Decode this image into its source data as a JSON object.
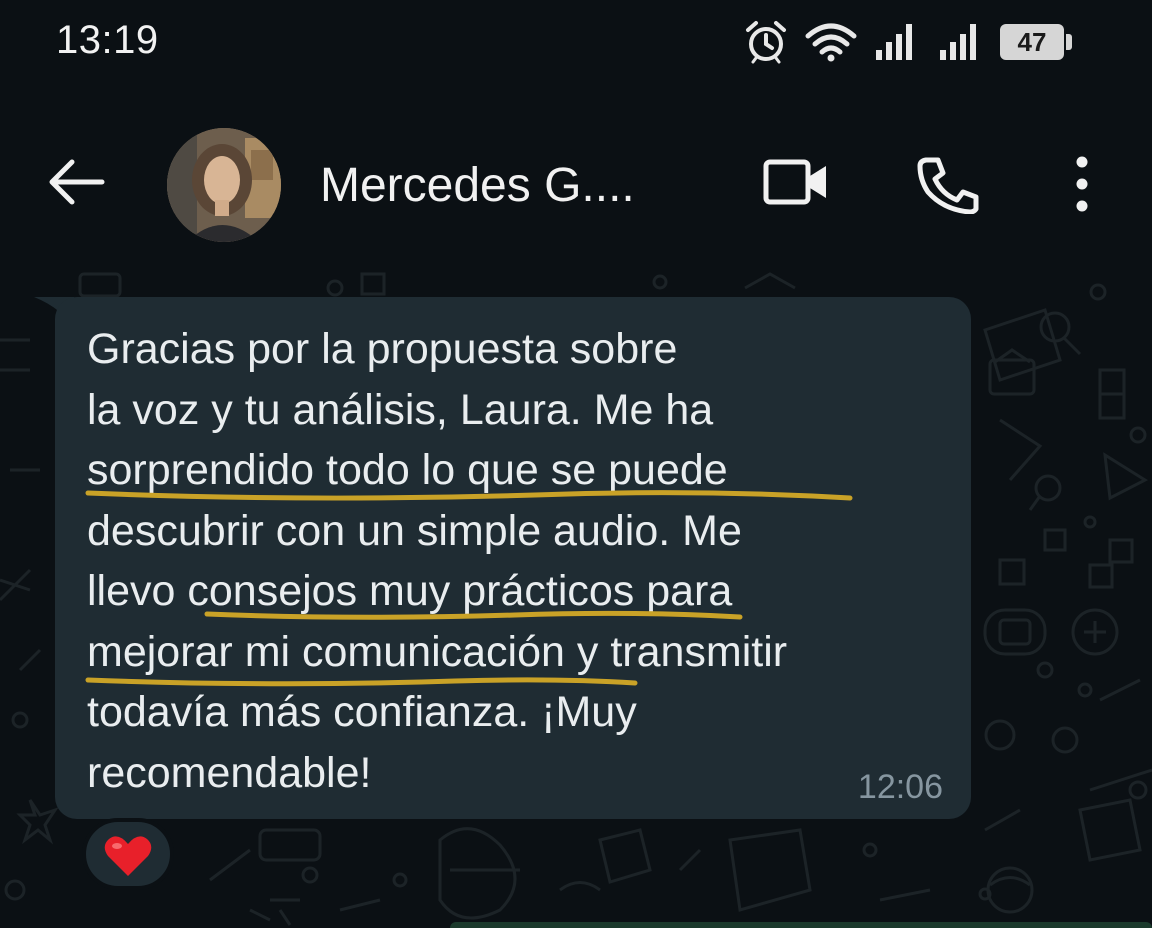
{
  "status_bar": {
    "time": "13:19",
    "battery": "47",
    "icons": [
      "alarm-icon",
      "wifi-icon",
      "signal-icon",
      "signal-icon"
    ]
  },
  "header": {
    "contact_name": "Mercedes G....",
    "icons": [
      "back-arrow-icon",
      "video-call-icon",
      "phone-icon",
      "more-options-icon"
    ]
  },
  "message": {
    "text": "Gracias por la propuesta sobre\nla voz y tu análisis, Laura. Me ha\nsorprendido todo lo que se puede\ndescubrir con un simple audio. Me\nllevo consejos muy prácticos para\nmejorar mi comunicación y transmitir\ntodavía más confianza. ¡Muy\nrecomendable!",
    "time": "12:06",
    "highlight_color": "#c9a227",
    "reaction": "heart-emoji"
  },
  "colors": {
    "background": "#0b1014",
    "bubble": "#1f2c33",
    "text": "#e9edef",
    "meta": "#8696a0"
  }
}
